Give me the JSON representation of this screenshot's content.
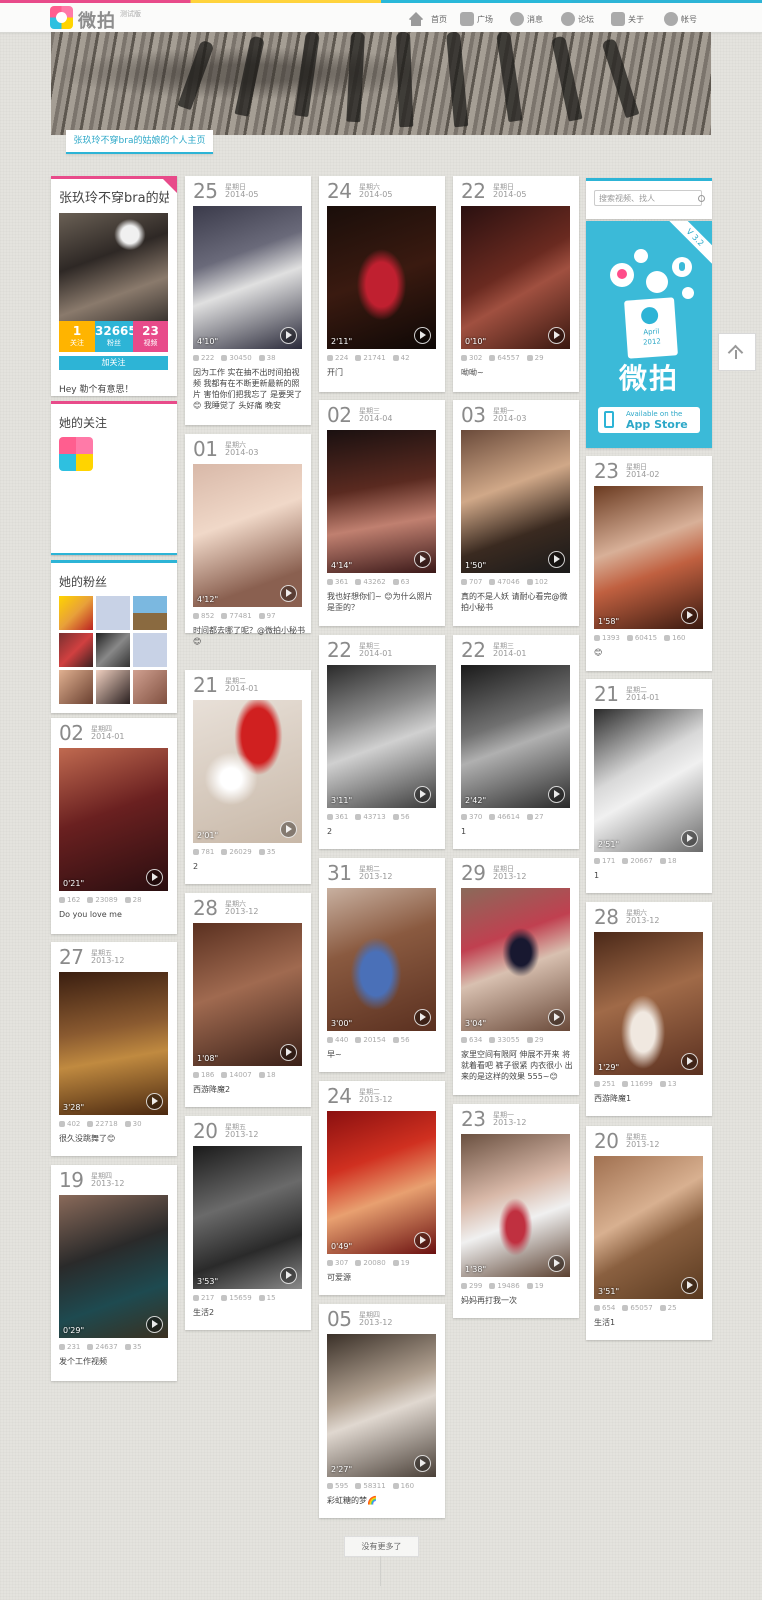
{
  "header": {
    "logo_text": "微拍",
    "logo_beta": "测试版",
    "nav": [
      {
        "label": "首页",
        "icon": "home-icon"
      },
      {
        "label": "广场",
        "icon": "tv-icon"
      },
      {
        "label": "消息",
        "icon": "chat-icon"
      },
      {
        "label": "论坛",
        "icon": "forum-icon"
      },
      {
        "label": "关于",
        "icon": "book-icon"
      },
      {
        "label": "帐号",
        "icon": "user-icon"
      }
    ]
  },
  "profile_tab": "张玖玲不穿bra的姑娘的个人主页",
  "profile": {
    "name": "张玖玲不穿bra的姑娘",
    "stats": [
      {
        "num": "1",
        "label": "关注",
        "color": "#ffb400"
      },
      {
        "num": "32665",
        "label": "粉丝",
        "color": "#2db4d6"
      },
      {
        "num": "23",
        "label": "视频",
        "color": "#e84b8a"
      }
    ],
    "follow_button": "加关注",
    "bio": "Hey 勒个有意思！"
  },
  "following": {
    "title": "她的关注"
  },
  "fans": {
    "title": "她的粉丝"
  },
  "search": {
    "placeholder": "搜索视频、找人"
  },
  "ad": {
    "version": "V 3.2",
    "doc_month": "April",
    "doc_year": "2012",
    "brand": "微拍",
    "store_line1": "Available on the",
    "store_line2": "App Store"
  },
  "load_more": "没有更多了",
  "videos": [
    {
      "day": "02",
      "week": "星期四",
      "ym": "2014-01",
      "dur": "0'21\"",
      "likes": "162",
      "plays": "23089",
      "comments": "28",
      "cap": "Do you love me"
    },
    {
      "day": "27",
      "week": "星期五",
      "ym": "2013-12",
      "dur": "3'28\"",
      "likes": "402",
      "plays": "22718",
      "comments": "30",
      "cap": "很久没跳舞了😊"
    },
    {
      "day": "19",
      "week": "星期四",
      "ym": "2013-12",
      "dur": "0'29\"",
      "likes": "231",
      "plays": "24637",
      "comments": "35",
      "cap": "发个工作视频"
    },
    {
      "day": "25",
      "week": "星期日",
      "ym": "2014-05",
      "dur": "4'10\"",
      "likes": "222",
      "plays": "30450",
      "comments": "38",
      "cap": "因为工作 实在抽不出时间拍视频 我都有在不断更新最新的照片 害怕你们把我忘了 是要哭了😊 我睡觉了 头好痛 晚安"
    },
    {
      "day": "01",
      "week": "星期六",
      "ym": "2014-03",
      "dur": "4'12\"",
      "likes": "852",
      "plays": "77481",
      "comments": "97",
      "cap": "时间都去哪了呢？@微拍小秘书 😊"
    },
    {
      "day": "21",
      "week": "星期二",
      "ym": "2014-01",
      "dur": "2'01\"",
      "likes": "781",
      "plays": "26029",
      "comments": "35",
      "cap": "2"
    },
    {
      "day": "28",
      "week": "星期六",
      "ym": "2013-12",
      "dur": "1'08\"",
      "likes": "186",
      "plays": "14007",
      "comments": "18",
      "cap": "西游降魔2"
    },
    {
      "day": "20",
      "week": "星期五",
      "ym": "2013-12",
      "dur": "3'53\"",
      "likes": "217",
      "plays": "15659",
      "comments": "15",
      "cap": "生活2"
    },
    {
      "day": "24",
      "week": "星期六",
      "ym": "2014-05",
      "dur": "2'11\"",
      "likes": "224",
      "plays": "21741",
      "comments": "42",
      "cap": "开门"
    },
    {
      "day": "02",
      "week": "星期三",
      "ym": "2014-04",
      "dur": "4'14\"",
      "likes": "361",
      "plays": "43262",
      "comments": "63",
      "cap": "我也好想你们~ 😊为什么照片是歪的？"
    },
    {
      "day": "22",
      "week": "星期三",
      "ym": "2014-01",
      "dur": "3'11\"",
      "likes": "361",
      "plays": "43713",
      "comments": "56",
      "cap": "2"
    },
    {
      "day": "31",
      "week": "星期二",
      "ym": "2013-12",
      "dur": "3'00\"",
      "likes": "440",
      "plays": "20154",
      "comments": "56",
      "cap": "早~"
    },
    {
      "day": "24",
      "week": "星期二",
      "ym": "2013-12",
      "dur": "0'49\"",
      "likes": "307",
      "plays": "20080",
      "comments": "19",
      "cap": "可爱源"
    },
    {
      "day": "05",
      "week": "星期四",
      "ym": "2013-12",
      "dur": "2'27\"",
      "likes": "595",
      "plays": "58311",
      "comments": "160",
      "cap": "彩虹糖的梦🌈"
    },
    {
      "day": "22",
      "week": "星期日",
      "ym": "2014-05",
      "dur": "0'10\"",
      "likes": "302",
      "plays": "64557",
      "comments": "29",
      "cap": "呦呦~"
    },
    {
      "day": "03",
      "week": "星期一",
      "ym": "2014-03",
      "dur": "1'50\"",
      "likes": "707",
      "plays": "47046",
      "comments": "102",
      "cap": "真的不是人妖 请耐心看完@微拍小秘书"
    },
    {
      "day": "22",
      "week": "星期三",
      "ym": "2014-01",
      "dur": "2'42\"",
      "likes": "370",
      "plays": "46614",
      "comments": "27",
      "cap": "1"
    },
    {
      "day": "29",
      "week": "星期日",
      "ym": "2013-12",
      "dur": "3'04\"",
      "likes": "634",
      "plays": "33055",
      "comments": "29",
      "cap": "家里空间有限阿 伸展不开来 将就着看吧 裤子很紧 内衣很小 出来的是这样的效果 555~😊"
    },
    {
      "day": "23",
      "week": "星期一",
      "ym": "2013-12",
      "dur": "1'38\"",
      "likes": "299",
      "plays": "19486",
      "comments": "19",
      "cap": "妈妈再打我一次"
    },
    {
      "day": "23",
      "week": "星期日",
      "ym": "2014-02",
      "dur": "1'58\"",
      "likes": "1393",
      "plays": "60415",
      "comments": "160",
      "cap": "😊"
    },
    {
      "day": "21",
      "week": "星期二",
      "ym": "2014-01",
      "dur": "2'51\"",
      "likes": "171",
      "plays": "20667",
      "comments": "18",
      "cap": "1"
    },
    {
      "day": "28",
      "week": "星期六",
      "ym": "2013-12",
      "dur": "1'29\"",
      "likes": "251",
      "plays": "11699",
      "comments": "13",
      "cap": "西游降魔1"
    },
    {
      "day": "20",
      "week": "星期五",
      "ym": "2013-12",
      "dur": "3'51\"",
      "likes": "654",
      "plays": "65057",
      "comments": "25",
      "cap": "生活1"
    }
  ],
  "colors": {
    "accent": "#2db4d6",
    "pink": "#e84b8a",
    "yellow": "#ffb400"
  }
}
